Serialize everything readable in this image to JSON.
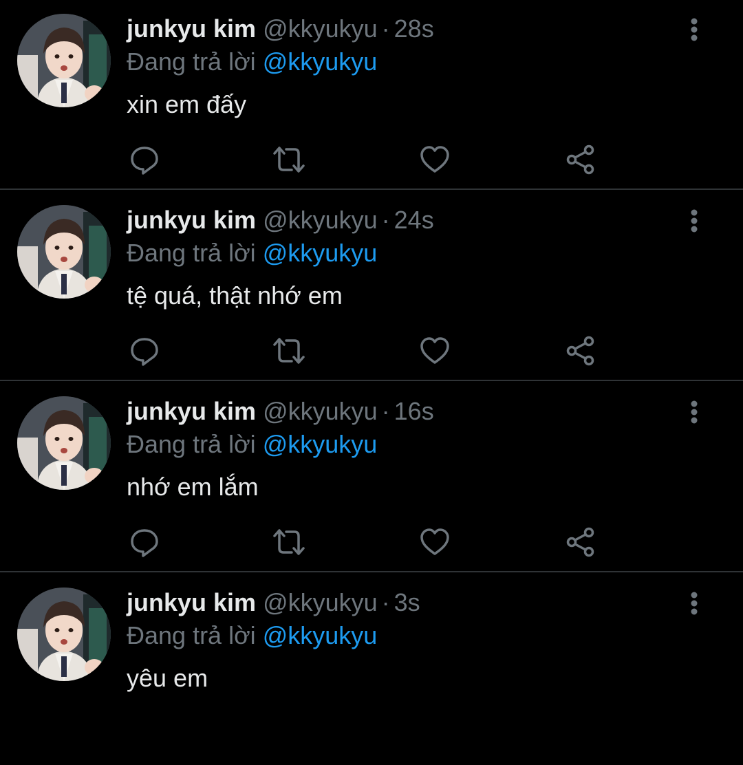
{
  "colors": {
    "background": "#000000",
    "text_primary": "#e7e9ea",
    "text_secondary": "#6e767d",
    "accent": "#1d9bf0",
    "divider": "#2f3336"
  },
  "icons": {
    "more": "more-vertical-icon",
    "reply": "reply-bubble-icon",
    "retweet": "retweet-icon",
    "like": "heart-icon",
    "share": "share-icon"
  },
  "tweets": [
    {
      "display_name": "junkyu kim",
      "handle": "@kkyukyu",
      "separator": "·",
      "time": "28s",
      "reply_prefix": "Đang trả lời",
      "reply_handle": "@kkyukyu",
      "text": "xin em đấy"
    },
    {
      "display_name": "junkyu kim",
      "handle": "@kkyukyu",
      "separator": "·",
      "time": "24s",
      "reply_prefix": "Đang trả lời",
      "reply_handle": "@kkyukyu",
      "text": "tệ quá, thật nhớ em"
    },
    {
      "display_name": "junkyu kim",
      "handle": "@kkyukyu",
      "separator": "·",
      "time": "16s",
      "reply_prefix": "Đang trả lời",
      "reply_handle": "@kkyukyu",
      "text": "nhớ em lắm"
    },
    {
      "display_name": "junkyu kim",
      "handle": "@kkyukyu",
      "separator": "·",
      "time": "3s",
      "reply_prefix": "Đang trả lời",
      "reply_handle": "@kkyukyu",
      "text": "yêu em"
    }
  ]
}
